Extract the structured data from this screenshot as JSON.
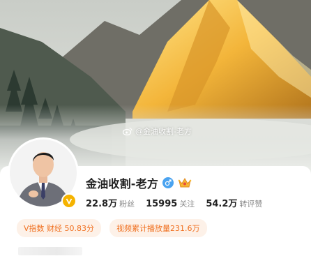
{
  "cover": {
    "watermark_text": "@金油收割-老方",
    "watermark_icon": "weibo-icon"
  },
  "profile": {
    "name": "金油收割-老方",
    "gender_icon": "male-icon",
    "badge_icon": "crown-icon",
    "verified_icon": "verified-v-icon",
    "verified_color": "#f5b300"
  },
  "stats": [
    {
      "value": "22.8万",
      "label": "粉丝"
    },
    {
      "value": "15995",
      "label": "关注"
    },
    {
      "value": "54.2万",
      "label": "转评赞"
    }
  ],
  "chips": [
    {
      "text": "V指数 财经 50.83分"
    },
    {
      "text": "视频累计播放量231.6万"
    }
  ],
  "colors": {
    "accent": "#f07020",
    "chip_bg": "#fdf1e8",
    "gender": "#4aa3f0"
  }
}
